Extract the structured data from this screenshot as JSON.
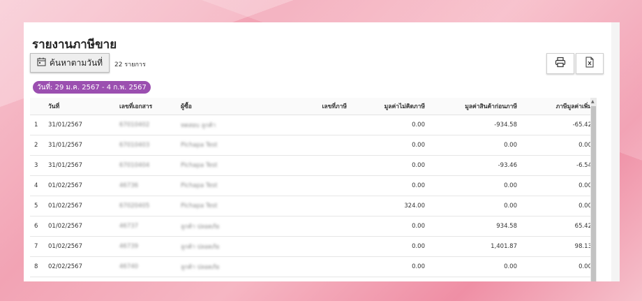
{
  "page": {
    "title": "รายงานภาษีขาย"
  },
  "toolbar": {
    "search_label": "ค้นหาตามวันที่",
    "count_label": "22 รายการ"
  },
  "filter": {
    "date_range": "วันที่: 29 ม.ค. 2567 - 4 ก.พ. 2567"
  },
  "table": {
    "headers": [
      "",
      "วันที่",
      "เลขที่เอกสาร",
      "ผู้ซื้อ",
      "เลขที่ภาษี",
      "มูลค่าไม่คิดภาษี",
      "มูลค่าสินค้าก่อนภาษี",
      "ภาษีมูลค่าเพิ่ม"
    ],
    "rows": [
      [
        "1",
        "31/01/2567",
        "67010402",
        "ทดสอบ ลูกค้า",
        "",
        "0.00",
        "-934.58",
        "-65.42"
      ],
      [
        "2",
        "31/01/2567",
        "67010403",
        "Pichapa Test",
        "",
        "0.00",
        "0.00",
        "0.00"
      ],
      [
        "3",
        "31/01/2567",
        "67010404",
        "Pichapa Test",
        "",
        "0.00",
        "-93.46",
        "-6.54"
      ],
      [
        "4",
        "01/02/2567",
        "46736",
        "Pichapa Test",
        "",
        "0.00",
        "0.00",
        "0.00"
      ],
      [
        "5",
        "01/02/2567",
        "67020405",
        "Pichapa Test",
        "",
        "324.00",
        "0.00",
        "0.00"
      ],
      [
        "6",
        "01/02/2567",
        "46737",
        "ลูกค้า ปลอดภัย",
        "",
        "0.00",
        "934.58",
        "65.42"
      ],
      [
        "7",
        "01/02/2567",
        "46739",
        "ลูกค้า ปลอดภัย",
        "",
        "0.00",
        "1,401.87",
        "98.13"
      ],
      [
        "8",
        "02/02/2567",
        "46740",
        "ลูกค้า ปลอดภัย",
        "",
        "0.00",
        "0.00",
        "0.00"
      ]
    ]
  },
  "icons": {
    "calendar": "calendar-icon",
    "print": "printer-icon",
    "excel": "excel-icon"
  },
  "colors": {
    "chip": "#9b4fb0"
  }
}
